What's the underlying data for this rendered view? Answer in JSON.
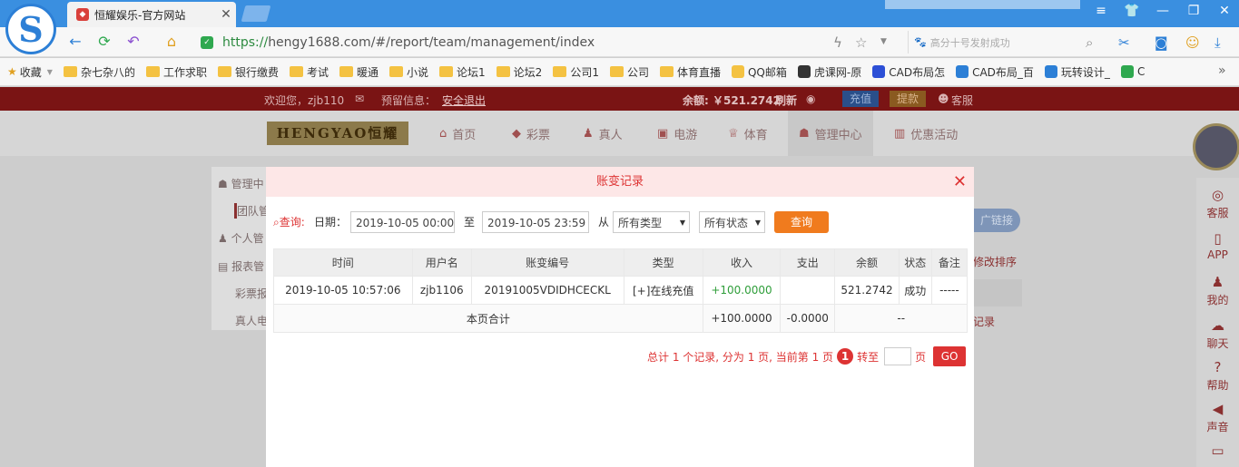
{
  "browser": {
    "tab_title": "恒耀娱乐-官方网站",
    "url_prefix": "https://",
    "url_rest": "hengy1688.com/#/report/team/management/index",
    "search_placeholder": "高分十号发射成功",
    "bookmarks": [
      "收藏",
      "杂七杂八的",
      "工作求职",
      "银行缴费",
      "考试",
      "暖通",
      "小说",
      "论坛1",
      "论坛2",
      "公司1",
      "公司",
      "体育直播",
      "QQ邮箱",
      "虎课网-原",
      "CAD布局怎",
      "CAD布局_百",
      "玩转设计_",
      "C"
    ]
  },
  "site": {
    "welcome": "欢迎您，zjb110",
    "notice": "预留信息：",
    "logout": "安全退出",
    "balance": "余额: ￥521.2742",
    "refresh": "刷新",
    "recharge": "充值",
    "withdraw": "提款",
    "service": "客服",
    "brand": "HENGYAO恒耀",
    "nav": [
      "首页",
      "彩票",
      "真人",
      "电游",
      "体育",
      "管理中心",
      "优惠活动"
    ],
    "sidebar": [
      "管理中",
      "团队管",
      "个人管",
      "报表管",
      "彩票报",
      "真人电"
    ],
    "bg_link": "广链接",
    "bg_sort": "修改排序",
    "bg_record": "记录",
    "rail": [
      "客服",
      "APP",
      "我的",
      "聊天",
      "帮助",
      "声音"
    ]
  },
  "modal": {
    "title": "账变记录",
    "query_label": "查询:",
    "date_label": "日期：",
    "date_from": "2019-10-05 00:00",
    "to_label": "至",
    "date_to": "2019-10-05 23:59",
    "from_label": "从",
    "type_select": "所有类型",
    "status_select": "所有状态",
    "query_button": "查询",
    "columns": [
      "时间",
      "用户名",
      "账变编号",
      "类型",
      "收入",
      "支出",
      "余额",
      "状态",
      "备注"
    ],
    "rows": [
      [
        "2019-10-05 10:57:06",
        "zjb1106",
        "20191005VDIDHCECKL",
        "[+]在线充值",
        "+100.0000",
        "",
        "521.2742",
        "成功",
        "-----"
      ]
    ],
    "total_label": "本页合计",
    "total_income": "+100.0000",
    "total_expense": "-0.0000",
    "total_balance": "--",
    "pager_text": "总计 1 个记录, 分为 1 页, 当前第 1 页",
    "pager_current": "1",
    "pager_goto": "转至",
    "pager_page": "页",
    "go": "GO"
  }
}
